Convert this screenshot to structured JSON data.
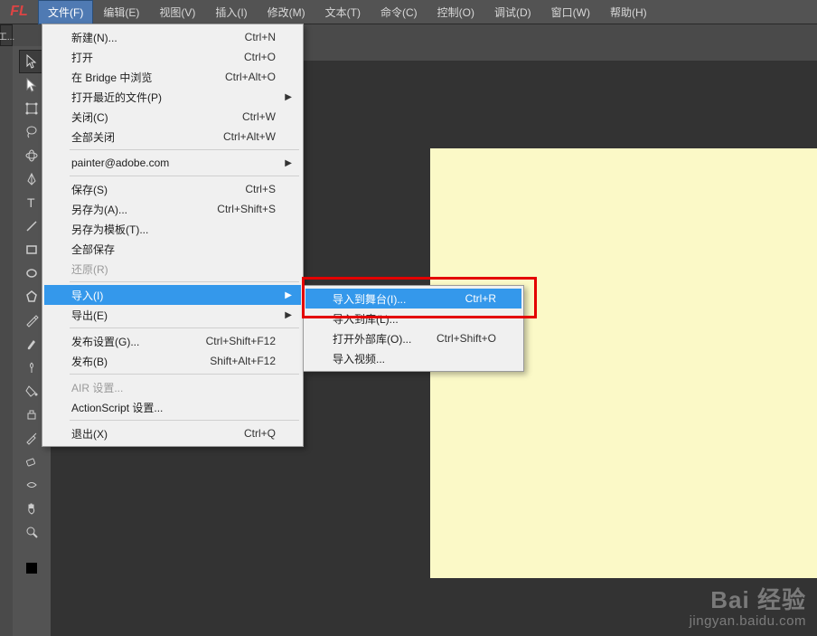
{
  "app": {
    "logo": "FL"
  },
  "menu": {
    "items": [
      "文件(F)",
      "编辑(E)",
      "视图(V)",
      "插入(I)",
      "修改(M)",
      "文本(T)",
      "命令(C)",
      "控制(O)",
      "调试(D)",
      "窗口(W)",
      "帮助(H)"
    ],
    "activeIndex": 0
  },
  "sideRail": {
    "label": "工..."
  },
  "fileMenu": {
    "groups": [
      [
        {
          "label": "新建(N)...",
          "shortcut": "Ctrl+N"
        },
        {
          "label": "打开",
          "shortcut": "Ctrl+O"
        },
        {
          "label": "在 Bridge 中浏览",
          "shortcut": "Ctrl+Alt+O"
        },
        {
          "label": "打开最近的文件(P)",
          "submenu": true
        },
        {
          "label": "关闭(C)",
          "shortcut": "Ctrl+W"
        },
        {
          "label": "全部关闭",
          "shortcut": "Ctrl+Alt+W"
        }
      ],
      [
        {
          "label": "painter@adobe.com",
          "submenu": true
        }
      ],
      [
        {
          "label": "保存(S)",
          "shortcut": "Ctrl+S"
        },
        {
          "label": "另存为(A)...",
          "shortcut": "Ctrl+Shift+S"
        },
        {
          "label": "另存为模板(T)..."
        },
        {
          "label": "全部保存"
        },
        {
          "label": "还原(R)",
          "disabled": true
        }
      ],
      [
        {
          "label": "导入(I)",
          "submenu": true,
          "highlight": true
        },
        {
          "label": "导出(E)",
          "submenu": true
        }
      ],
      [
        {
          "label": "发布设置(G)...",
          "shortcut": "Ctrl+Shift+F12"
        },
        {
          "label": "发布(B)",
          "shortcut": "Shift+Alt+F12"
        }
      ],
      [
        {
          "label": "AIR 设置...",
          "disabled": true
        },
        {
          "label": "ActionScript 设置..."
        }
      ],
      [
        {
          "label": "退出(X)",
          "shortcut": "Ctrl+Q"
        }
      ]
    ]
  },
  "importSubmenu": {
    "items": [
      {
        "label": "导入到舞台(I)...",
        "shortcut": "Ctrl+R",
        "highlight": true
      },
      {
        "label": "导入到库(L)..."
      },
      {
        "label": "打开外部库(O)...",
        "shortcut": "Ctrl+Shift+O"
      },
      {
        "label": "导入视频..."
      }
    ]
  },
  "stage": {
    "color": "#fbf9c7"
  },
  "watermark": {
    "brand": "Bai",
    "brand2": "经验",
    "url": "jingyan.baidu.com"
  }
}
